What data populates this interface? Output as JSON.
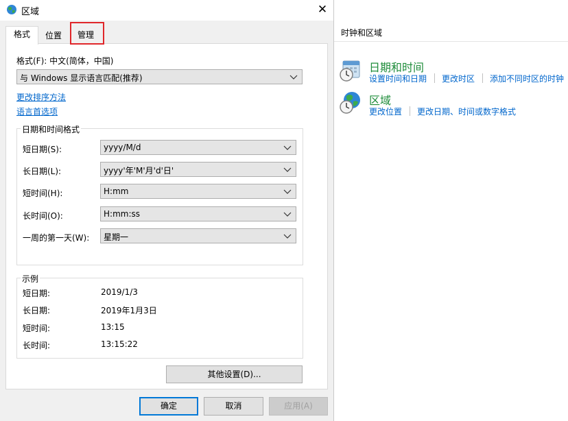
{
  "dialog": {
    "title": "区域",
    "tabs": [
      "格式",
      "位置",
      "管理"
    ],
    "format_label": "格式(F): 中文(简体，中国)",
    "format_combo": "与 Windows 显示语言匹配(推荐)",
    "link_sort": "更改排序方法",
    "link_lang": "语言首选项",
    "datetime_group": {
      "title": "日期和时间格式",
      "rows": [
        {
          "label": "短日期(S):",
          "value": "yyyy/M/d"
        },
        {
          "label": "长日期(L):",
          "value": "yyyy'年'M'月'd'日'"
        },
        {
          "label": "短时间(H):",
          "value": "H:mm"
        },
        {
          "label": "长时间(O):",
          "value": "H:mm:ss"
        },
        {
          "label": "一周的第一天(W):",
          "value": "星期一"
        }
      ]
    },
    "example_group": {
      "title": "示例",
      "rows": [
        {
          "label": "短日期:",
          "value": "2019/1/3"
        },
        {
          "label": "长日期:",
          "value": "2019年1月3日"
        },
        {
          "label": "短时间:",
          "value": "13:15"
        },
        {
          "label": "长时间:",
          "value": "13:15:22"
        }
      ]
    },
    "other_settings_button": "其他设置(D)...",
    "ok_button": "确定",
    "cancel_button": "取消",
    "apply_button": "应用(A)"
  },
  "control_panel": {
    "header": "时钟和区域",
    "datetime": {
      "title": "日期和时间",
      "links": [
        "设置时间和日期",
        "更改时区",
        "添加不同时区的时钟"
      ]
    },
    "region": {
      "title": "区域",
      "links": [
        "更改位置",
        "更改日期、时间或数字格式"
      ]
    }
  },
  "colors": {
    "link": "#0066cc",
    "category_title": "#1e8c3a",
    "highlight_box": "#e0262a",
    "default_button_border": "#0078d7"
  },
  "icons": [
    "globe-icon",
    "close-icon",
    "calendar-clock-icon",
    "globe-clock-icon",
    "chevron-down-icon"
  ]
}
